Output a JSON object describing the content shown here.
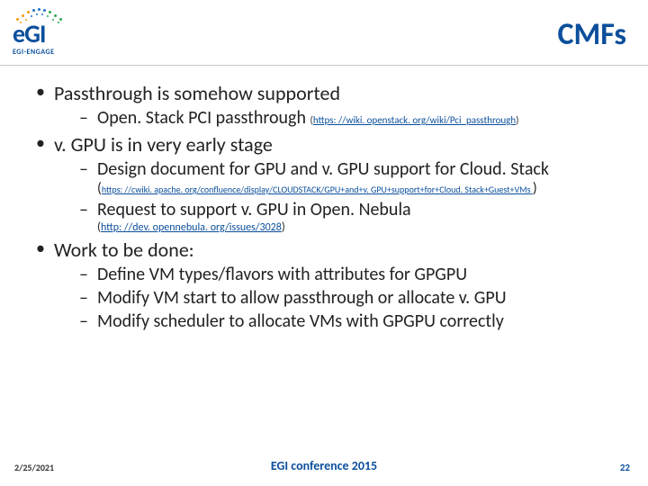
{
  "logo": {
    "brand": "eGI",
    "subtitle": "EGI-ENGAGE"
  },
  "title": "CMFs",
  "bullets": {
    "b1": "Passthrough is somehow supported",
    "b1a_text": "Open. Stack PCI passthrough ",
    "b1a_link": "https: //wiki. openstack. org/wiki/Pci_passthrough",
    "b2": "v. GPU is in very early stage",
    "b2a": "Design document for GPU and v. GPU support for Cloud. Stack",
    "b2a_link": "https: //cwiki. apache. org/confluence/display/CLOUDSTACK/GPU+and+v. GPU+support+for+Cloud. Stack+Guest+VMs ",
    "b2b": "Request to support v. GPU in Open. Nebula",
    "b2b_link": "http: //dev. opennebula. org/issues/3028",
    "b3": "Work to be done:",
    "b3a": "Define VM types/flavors with attributes for GPGPU",
    "b3b": "Modify VM start to allow passthrough or allocate v. GPU",
    "b3c": "Modify scheduler to allocate VMs with GPGPU correctly"
  },
  "footer": {
    "date": "2/25/2021",
    "center": "EGI conference 2015",
    "page": "22"
  },
  "colors": {
    "brand": "#0b4f9c",
    "orange": "#f39c12",
    "blue": "#1e74c8",
    "green": "#2ea84f"
  }
}
